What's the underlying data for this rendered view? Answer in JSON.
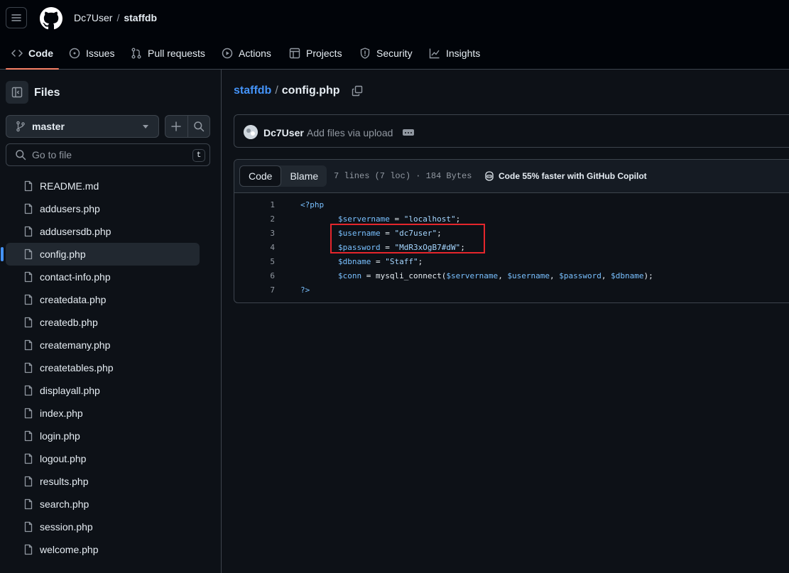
{
  "header": {
    "owner": "Dc7User",
    "separator": "/",
    "repo": "staffdb"
  },
  "nav": {
    "tabs": [
      {
        "label": "Code",
        "icon": "code-icon",
        "active": true
      },
      {
        "label": "Issues",
        "icon": "issue-opened-icon"
      },
      {
        "label": "Pull requests",
        "icon": "git-pull-request-icon"
      },
      {
        "label": "Actions",
        "icon": "play-icon"
      },
      {
        "label": "Projects",
        "icon": "table-icon"
      },
      {
        "label": "Security",
        "icon": "shield-icon"
      },
      {
        "label": "Insights",
        "icon": "graph-icon"
      }
    ]
  },
  "sidebar": {
    "title": "Files",
    "branch": "master",
    "search_placeholder": "Go to file",
    "search_shortcut": "t",
    "files": [
      "README.md",
      "addusers.php",
      "addusersdb.php",
      "config.php",
      "contact-info.php",
      "createdata.php",
      "createdb.php",
      "createmany.php",
      "createtables.php",
      "displayall.php",
      "index.php",
      "login.php",
      "logout.php",
      "results.php",
      "search.php",
      "session.php",
      "welcome.php"
    ],
    "active_file": "config.php"
  },
  "path": {
    "repo": "staffdb",
    "separator": "/",
    "file": "config.php"
  },
  "commit": {
    "author": "Dc7User",
    "message": "Add files via upload"
  },
  "code_view": {
    "tab_code": "Code",
    "tab_blame": "Blame",
    "file_info": "7 lines (7 loc) · 184 Bytes",
    "copilot_promo": "Code 55% faster with GitHub Copilot",
    "lines": [
      {
        "n": "1",
        "indent": "",
        "tokens": [
          {
            "t": "<?php",
            "k": "tag"
          }
        ]
      },
      {
        "n": "2",
        "indent": "        ",
        "tokens": [
          {
            "t": "$servername",
            "k": "var"
          },
          {
            "t": " = ",
            "k": "plain"
          },
          {
            "t": "\"localhost\"",
            "k": "str"
          },
          {
            "t": ";",
            "k": "plain"
          }
        ]
      },
      {
        "n": "3",
        "indent": "        ",
        "tokens": [
          {
            "t": "$username",
            "k": "var"
          },
          {
            "t": " = ",
            "k": "plain"
          },
          {
            "t": "\"dc7user\"",
            "k": "str"
          },
          {
            "t": ";",
            "k": "plain"
          }
        ]
      },
      {
        "n": "4",
        "indent": "        ",
        "tokens": [
          {
            "t": "$password",
            "k": "var"
          },
          {
            "t": " = ",
            "k": "plain"
          },
          {
            "t": "\"MdR3xOgB7#dW\"",
            "k": "str"
          },
          {
            "t": ";",
            "k": "plain"
          }
        ]
      },
      {
        "n": "5",
        "indent": "        ",
        "tokens": [
          {
            "t": "$dbname",
            "k": "var"
          },
          {
            "t": " = ",
            "k": "plain"
          },
          {
            "t": "\"Staff\"",
            "k": "str"
          },
          {
            "t": ";",
            "k": "plain"
          }
        ]
      },
      {
        "n": "6",
        "indent": "        ",
        "tokens": [
          {
            "t": "$conn",
            "k": "var"
          },
          {
            "t": " = mysqli_connect(",
            "k": "plain"
          },
          {
            "t": "$servername",
            "k": "var"
          },
          {
            "t": ", ",
            "k": "plain"
          },
          {
            "t": "$username",
            "k": "var"
          },
          {
            "t": ", ",
            "k": "plain"
          },
          {
            "t": "$password",
            "k": "var"
          },
          {
            "t": ", ",
            "k": "plain"
          },
          {
            "t": "$dbname",
            "k": "var"
          },
          {
            "t": ");",
            "k": "plain"
          }
        ]
      },
      {
        "n": "7",
        "indent": "",
        "tokens": [
          {
            "t": "?>",
            "k": "tag"
          }
        ]
      }
    ]
  },
  "colors": {
    "accent_link": "#4493f8",
    "active_tab_underline": "#f78166",
    "highlight_box": "#e5262c"
  }
}
